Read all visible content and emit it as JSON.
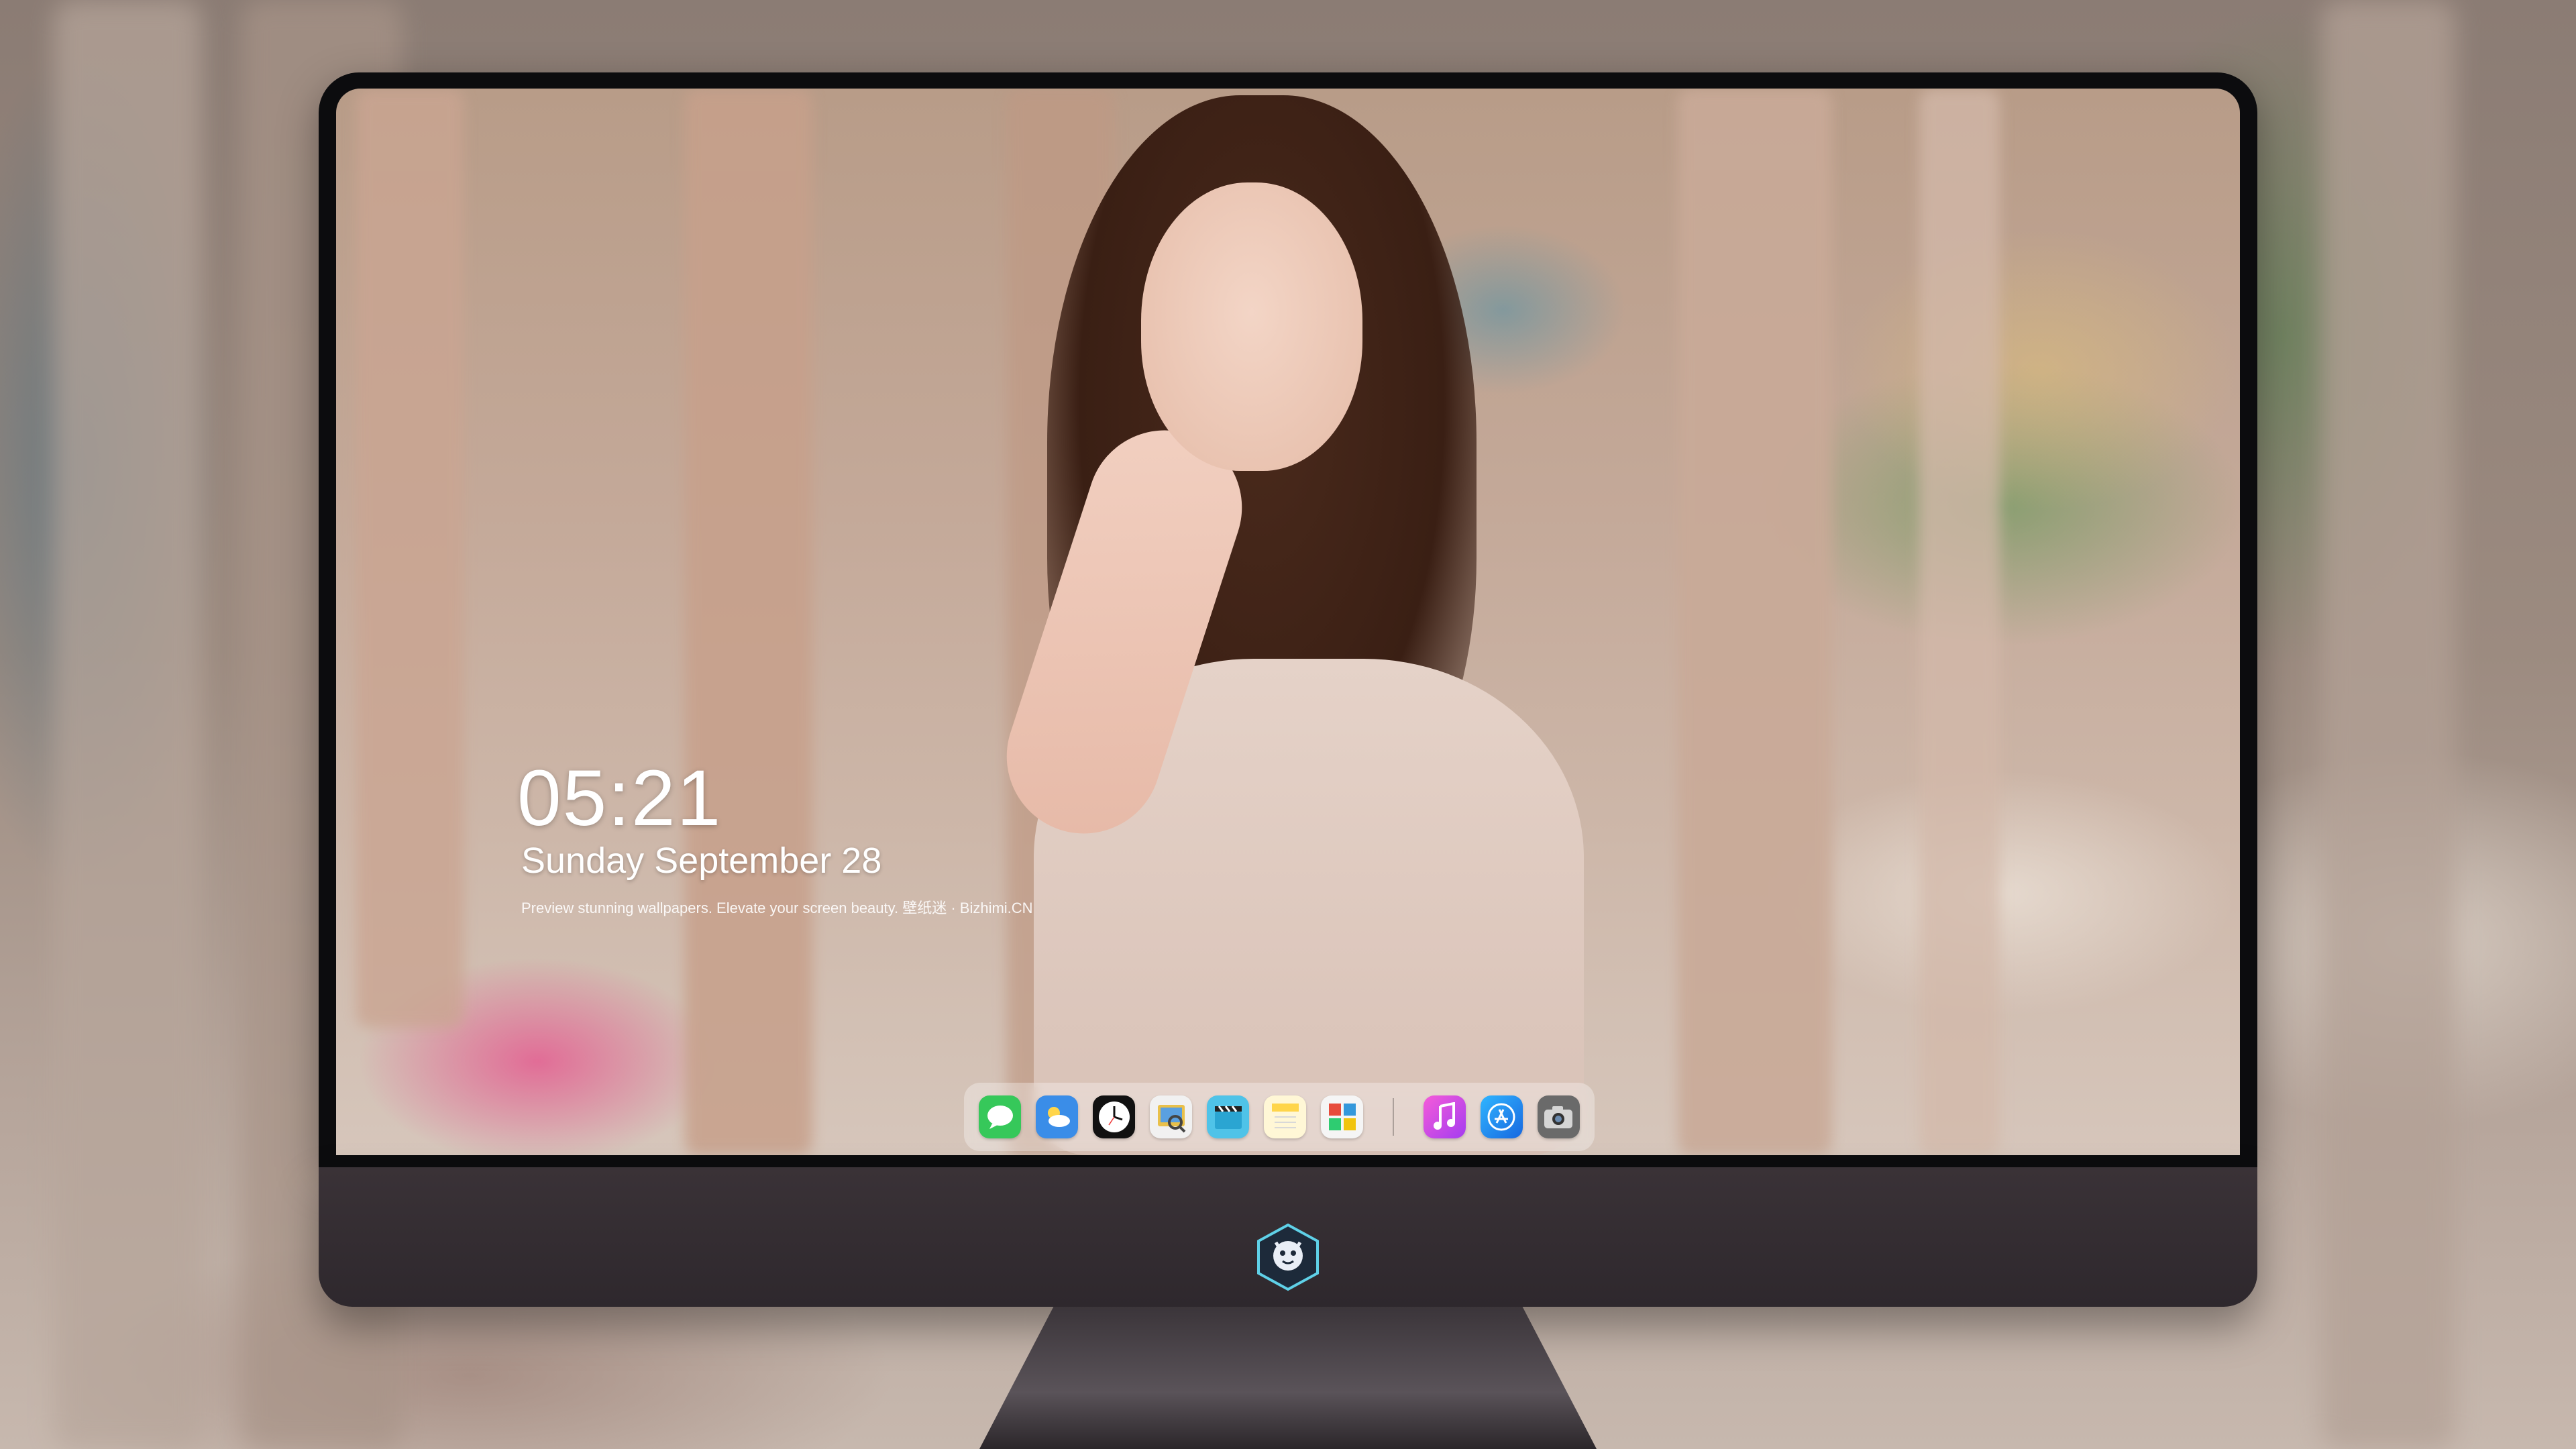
{
  "lockscreen": {
    "time": "05:21",
    "date": "Sunday September  28",
    "tagline": "Preview stunning wallpapers. Elevate your screen beauty. 壁纸迷 · Bizhimi.CN"
  },
  "dock": {
    "apps": [
      {
        "name": "Messages",
        "icon": "message-bubble-icon",
        "color": "#36c85a"
      },
      {
        "name": "Weather",
        "icon": "weather-icon",
        "color": "#3a8de8"
      },
      {
        "name": "Clock",
        "icon": "clock-icon",
        "color": "#111111"
      },
      {
        "name": "Preview",
        "icon": "preview-icon",
        "color": "#f1f1f1"
      },
      {
        "name": "Clips",
        "icon": "clapperboard-icon",
        "color": "#4fc3e8"
      },
      {
        "name": "Notes",
        "icon": "notes-icon",
        "color": "#ffd54a"
      },
      {
        "name": "Photo Booth",
        "icon": "photo-booth-icon",
        "color": "#f5f5f5"
      },
      {
        "name": "Music",
        "icon": "music-note-icon",
        "color": "#c64cf5"
      },
      {
        "name": "App Store",
        "icon": "app-store-icon",
        "color": "#1e8bf0"
      },
      {
        "name": "Camera",
        "icon": "camera-icon",
        "color": "#6a6a6a"
      }
    ]
  },
  "colors": {
    "bezel": "#0c0c0e",
    "chin": "#3a3237",
    "text": "#ffffff"
  }
}
